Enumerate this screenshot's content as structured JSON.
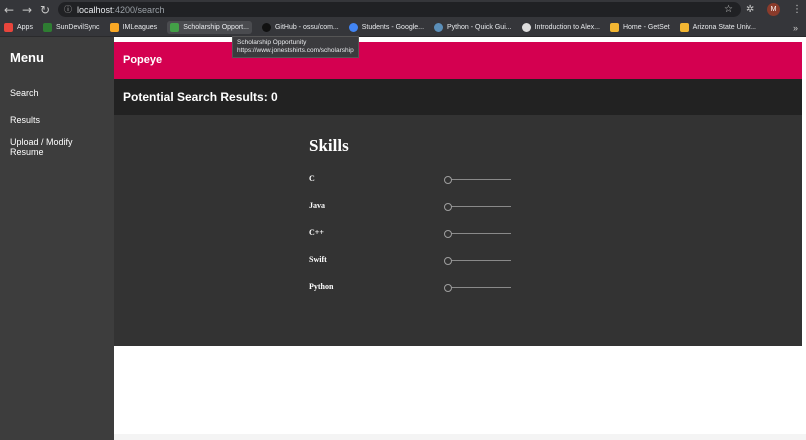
{
  "browser": {
    "url_host": "localhost",
    "url_path": ":4200/search",
    "profile_initial": "M",
    "bookmarks": [
      {
        "label": "Apps",
        "color": "#e8453c"
      },
      {
        "label": "SunDevilSync",
        "color": "#2e7d32"
      },
      {
        "label": "IMLeagues",
        "color": "#f9a825"
      },
      {
        "label": "Scholarship Opport...",
        "color": "#43a047"
      },
      {
        "label": "GitHub - ossu/com...",
        "color": "#111111"
      },
      {
        "label": "Students - Google...",
        "color": "#4285f4"
      },
      {
        "label": "Python - Quick Gui...",
        "color": "#5b8fb9"
      },
      {
        "label": "Introduction to Alex...",
        "color": "#dddddd"
      },
      {
        "label": "Home - GetSet",
        "color": "#f2b632"
      },
      {
        "label": "Arizona State Univ...",
        "color": "#f2b632"
      }
    ],
    "tooltip": {
      "title": "Scholarship Opportunity",
      "url": "https://www.jonestshirts.com/scholarship"
    }
  },
  "sidebar": {
    "title": "Menu",
    "items": [
      {
        "label": "Search"
      },
      {
        "label": "Results"
      },
      {
        "label": "Upload / Modify Resume"
      }
    ]
  },
  "header": {
    "title": "Popeye",
    "accent_color": "#d40050"
  },
  "results": {
    "label": "Potential Search Results: 0"
  },
  "skills": {
    "title": "Skills",
    "items": [
      {
        "name": "C",
        "level": 0
      },
      {
        "name": "Java",
        "level": 0
      },
      {
        "name": "C++",
        "level": 0
      },
      {
        "name": "Swift",
        "level": 0
      },
      {
        "name": "Python",
        "level": 0
      }
    ]
  }
}
